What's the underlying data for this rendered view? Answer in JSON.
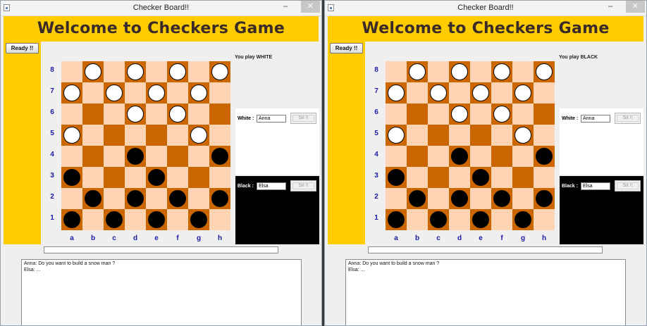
{
  "title": "Checker Board!!",
  "minimize_glyph": "–",
  "close_glyph": "✕",
  "banner_text": "Welcome to Checkers Game",
  "ready_label": "Ready !!",
  "ranks": [
    "8",
    "7",
    "6",
    "5",
    "4",
    "3",
    "2",
    "1"
  ],
  "files": [
    "a",
    "b",
    "c",
    "d",
    "e",
    "f",
    "g",
    "h"
  ],
  "colors": {
    "banner": "#ffcc00",
    "light_square": "#ffd4b5",
    "dark_square": "#cc6600",
    "coord_text": "#1a1aa8"
  },
  "board": [
    [
      " ",
      "W",
      " ",
      "W",
      " ",
      "W",
      " ",
      "W"
    ],
    [
      "W",
      " ",
      "W",
      " ",
      "W",
      " ",
      "W",
      " "
    ],
    [
      " ",
      " ",
      " ",
      "W",
      " ",
      "W",
      " ",
      " "
    ],
    [
      "W",
      " ",
      " ",
      " ",
      " ",
      " ",
      "W",
      " "
    ],
    [
      " ",
      " ",
      " ",
      "B",
      " ",
      " ",
      " ",
      "B"
    ],
    [
      "B",
      " ",
      " ",
      " ",
      "B",
      " ",
      " ",
      " "
    ],
    [
      " ",
      "B",
      " ",
      "B",
      " ",
      "B",
      " ",
      "B"
    ],
    [
      "B",
      " ",
      "B",
      " ",
      "B",
      " ",
      "B",
      " "
    ]
  ],
  "white_player": {
    "label": "White :",
    "name": "Anna",
    "sit_label": "Sit !!"
  },
  "black_player": {
    "label": "Black :",
    "name": "Elsa",
    "sit_label": "Sit !!"
  },
  "chat_lines": [
    "Anna: Do you want to build a snow man ?",
    "Elsa: ..."
  ],
  "left_window": {
    "you_play": "You play WHITE"
  },
  "right_window": {
    "you_play": "You play BLACK"
  }
}
